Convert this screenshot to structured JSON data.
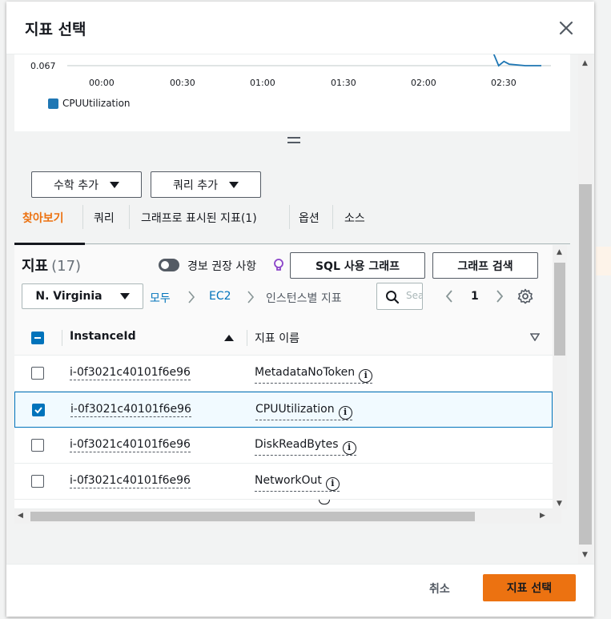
{
  "modal": {
    "title": "지표 선택"
  },
  "chart_data": {
    "type": "line",
    "x_ticks": [
      "00:00",
      "00:30",
      "01:00",
      "01:30",
      "02:00",
      "02:30"
    ],
    "y_ticks": [
      "0.067"
    ],
    "series": [
      {
        "name": "CPUUtilization",
        "color": "#1f77b4",
        "x": [
          "02:24",
          "02:26",
          "02:28",
          "02:30",
          "02:36",
          "02:42"
        ],
        "values": [
          0.08,
          0.067,
          0.07,
          0.068,
          0.067,
          0.067
        ]
      }
    ]
  },
  "buttons": {
    "math": "수학 추가",
    "query": "쿼리 추가",
    "sql_graph": "SQL 사용 그래프",
    "graph_search": "그래프 검색"
  },
  "tabs": [
    "찾아보기",
    "쿼리",
    "그래프로 표시된 지표(1)",
    "옵션",
    "소스"
  ],
  "metrics": {
    "title": "지표",
    "count": "(17)",
    "alarm_reco": "경보 권장 사항",
    "region": "N. Virginia",
    "breadcrumb": [
      "모두",
      "EC2",
      "인스턴스별 지표"
    ],
    "search_placeholder": "Search",
    "page": "1",
    "columns": [
      "InstanceId",
      "지표 이름"
    ],
    "rows": [
      {
        "id": "i-0f3021c40101f6e96",
        "name": "MetadataNoToken",
        "checked": false
      },
      {
        "id": "i-0f3021c40101f6e96",
        "name": "CPUUtilization",
        "checked": true
      },
      {
        "id": "i-0f3021c40101f6e96",
        "name": "DiskReadBytes",
        "checked": false
      },
      {
        "id": "i-0f3021c40101f6e96",
        "name": "NetworkOut",
        "checked": false
      }
    ]
  },
  "footer": {
    "cancel": "취소",
    "confirm": "지표 선택"
  },
  "colors": {
    "accent": "#ec7211",
    "link": "#0073bb",
    "series": "#1f77b4"
  }
}
